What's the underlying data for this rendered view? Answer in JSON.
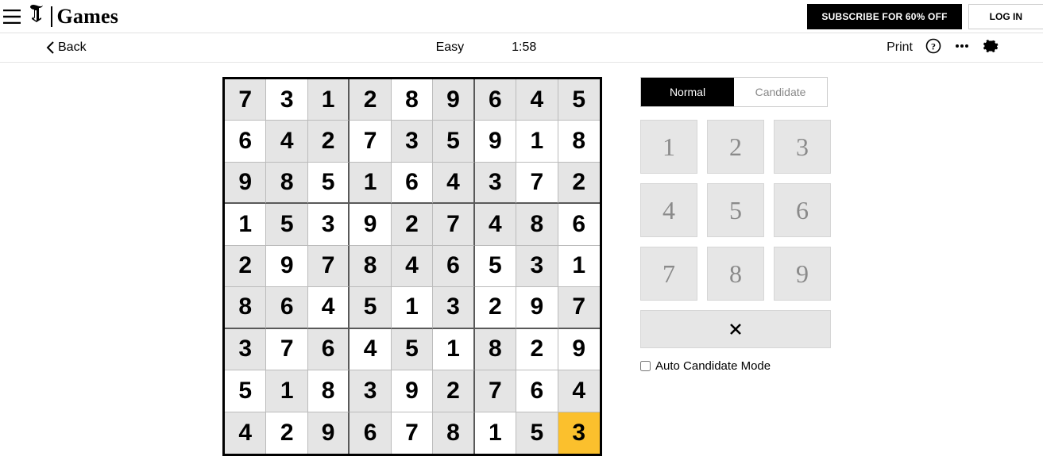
{
  "header": {
    "brand": "Games",
    "subscribe_label": "SUBSCRIBE FOR 60% OFF",
    "login_label": "LOG IN",
    "t_logo": "€"
  },
  "subbar": {
    "back_label": "Back",
    "difficulty": "Easy",
    "timer": "1:58",
    "print_label": "Print"
  },
  "board": {
    "grid": [
      [
        7,
        3,
        1,
        2,
        8,
        9,
        6,
        4,
        5
      ],
      [
        6,
        4,
        2,
        7,
        3,
        5,
        9,
        1,
        8
      ],
      [
        9,
        8,
        5,
        1,
        6,
        4,
        3,
        7,
        2
      ],
      [
        1,
        5,
        3,
        9,
        2,
        7,
        4,
        8,
        6
      ],
      [
        2,
        9,
        7,
        8,
        4,
        6,
        5,
        3,
        1
      ],
      [
        8,
        6,
        4,
        5,
        1,
        3,
        2,
        9,
        7
      ],
      [
        3,
        7,
        6,
        4,
        5,
        1,
        8,
        2,
        9
      ],
      [
        5,
        1,
        8,
        3,
        9,
        2,
        7,
        6,
        4
      ],
      [
        4,
        2,
        9,
        6,
        7,
        8,
        1,
        5,
        3
      ]
    ],
    "given": [
      [
        1,
        0,
        1,
        1,
        0,
        1,
        1,
        1,
        1
      ],
      [
        0,
        1,
        1,
        0,
        1,
        1,
        0,
        0,
        0
      ],
      [
        1,
        1,
        0,
        1,
        0,
        1,
        1,
        0,
        1
      ],
      [
        0,
        1,
        0,
        0,
        1,
        1,
        1,
        1,
        0
      ],
      [
        1,
        0,
        1,
        1,
        1,
        1,
        0,
        1,
        0
      ],
      [
        1,
        1,
        0,
        1,
        0,
        1,
        0,
        0,
        1
      ],
      [
        1,
        0,
        1,
        0,
        1,
        0,
        1,
        0,
        0
      ],
      [
        0,
        1,
        0,
        1,
        0,
        1,
        1,
        0,
        1
      ],
      [
        1,
        0,
        1,
        1,
        0,
        1,
        0,
        1,
        1
      ]
    ],
    "selected": [
      8,
      8
    ]
  },
  "panel": {
    "mode_normal": "Normal",
    "mode_candidate": "Candidate",
    "numbers": [
      "1",
      "2",
      "3",
      "4",
      "5",
      "6",
      "7",
      "8",
      "9"
    ],
    "auto_candidate_label": "Auto Candidate Mode"
  }
}
